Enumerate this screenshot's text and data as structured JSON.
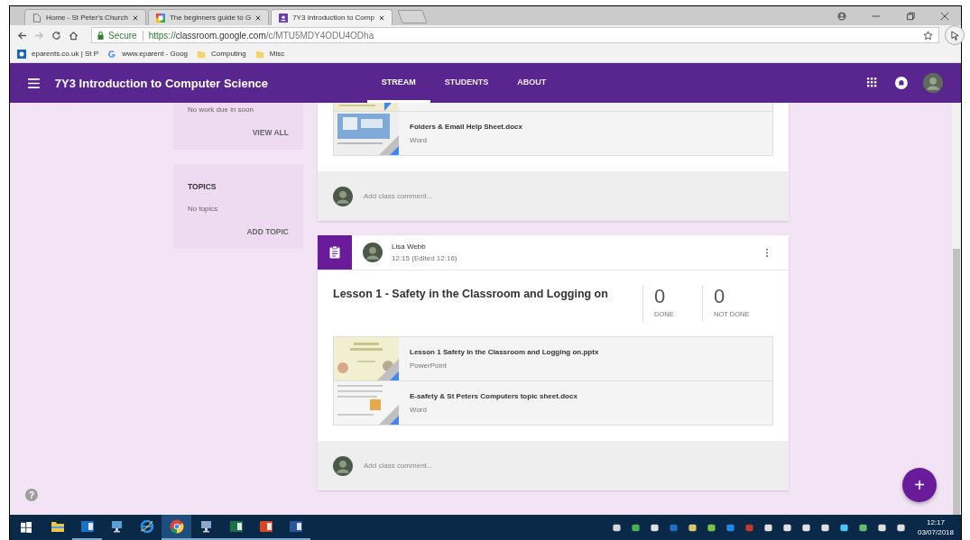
{
  "browser": {
    "tabs": [
      {
        "title": "Home - St Peter's Church",
        "selected": false
      },
      {
        "title": "The beginners guide to G",
        "selected": false
      },
      {
        "title": "7Y3 Introduction to Comp",
        "selected": true
      }
    ],
    "secure_label": "Secure",
    "url_scheme": "https://",
    "url_host": "classroom.google.com",
    "url_path": "/c/MTU5MDY4ODU4ODha",
    "bookmarks": [
      {
        "label": "eparents.co.uk | St P"
      },
      {
        "label": "www.eparent - Goog"
      },
      {
        "label": "Computing"
      },
      {
        "label": "Misc"
      }
    ]
  },
  "app_bar": {
    "title": "7Y3 Introduction to Computer Science",
    "nav": [
      {
        "label": "STREAM",
        "selected": true
      },
      {
        "label": "STUDENTS",
        "selected": false
      },
      {
        "label": "ABOUT",
        "selected": false
      }
    ]
  },
  "sidebar": {
    "upcoming": {
      "text": "No work due in soon",
      "action": "VIEW ALL"
    },
    "topics": {
      "title": "TOPICS",
      "text": "No topics",
      "action": "ADD TOPIC"
    }
  },
  "posts": [
    {
      "kind": "partial",
      "attachments": [
        {
          "name": "Folders & Email Help Sheet.docx",
          "type": "Word"
        }
      ],
      "comment_placeholder": "Add class comment..."
    },
    {
      "kind": "assignment",
      "author": "Lisa Webb",
      "time": "12:15 (Edited 12:16)",
      "title": "Lesson 1 - Safety in the Classroom and Logging on",
      "stats": [
        {
          "value": "0",
          "label": "DONE"
        },
        {
          "value": "0",
          "label": "NOT DONE"
        }
      ],
      "attachments": [
        {
          "name": "Lesson 1 Safety in the Classroom and Logging on.pptx",
          "type": "PowerPoint"
        },
        {
          "name": "E-safety & St Peters Computers topic sheet.docx",
          "type": "Word"
        }
      ],
      "comment_placeholder": "Add class comment..."
    }
  ],
  "help": "?",
  "fab": "+",
  "taskbar": {
    "apps": [
      {
        "running": false,
        "selected": false
      },
      {
        "running": true,
        "selected": false
      },
      {
        "running": false,
        "selected": false
      },
      {
        "running": false,
        "selected": false
      },
      {
        "running": true,
        "selected": true
      },
      {
        "running": true,
        "selected": false
      },
      {
        "running": true,
        "selected": false
      },
      {
        "running": true,
        "selected": false
      },
      {
        "running": true,
        "selected": false
      }
    ],
    "time": "12:17",
    "date": "03/07/2018"
  }
}
